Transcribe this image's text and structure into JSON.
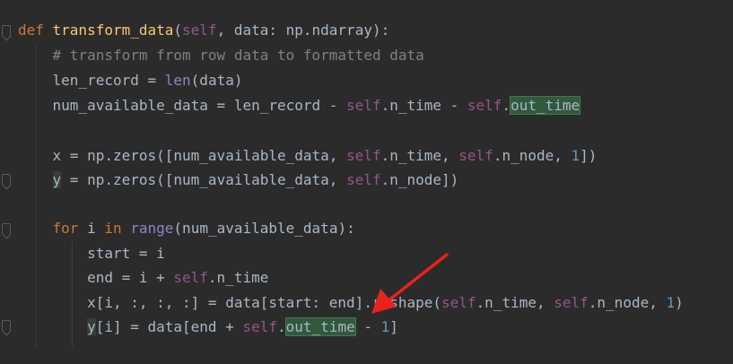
{
  "code": {
    "lines": [
      {
        "tokens": [
          {
            "t": "def ",
            "c": "kw"
          },
          {
            "t": "transform_data",
            "c": "fn"
          },
          {
            "t": "(",
            "c": ""
          },
          {
            "t": "self",
            "c": "self"
          },
          {
            "t": ", data: np.ndarray):",
            "c": ""
          }
        ]
      },
      {
        "tokens": [
          {
            "t": "    # transform from row data to formatted data",
            "c": "cmt"
          }
        ]
      },
      {
        "tokens": [
          {
            "t": "    len_record = ",
            "c": ""
          },
          {
            "t": "len",
            "c": "builtin"
          },
          {
            "t": "(data)",
            "c": ""
          }
        ]
      },
      {
        "tokens": [
          {
            "t": "    num_available_data = len_record - ",
            "c": ""
          },
          {
            "t": "self",
            "c": "self"
          },
          {
            "t": ".n_time - ",
            "c": ""
          },
          {
            "t": "self",
            "c": "self"
          },
          {
            "t": ".",
            "c": ""
          },
          {
            "t": "out_time",
            "c": "hl"
          }
        ]
      },
      {
        "tokens": []
      },
      {
        "tokens": [
          {
            "t": "    x = np.zeros([num_available_data, ",
            "c": ""
          },
          {
            "t": "self",
            "c": "self"
          },
          {
            "t": ".n_time, ",
            "c": ""
          },
          {
            "t": "self",
            "c": "self"
          },
          {
            "t": ".n_node, ",
            "c": ""
          },
          {
            "t": "1",
            "c": "num"
          },
          {
            "t": "])",
            "c": ""
          }
        ]
      },
      {
        "tokens": [
          {
            "t": "    ",
            "c": ""
          },
          {
            "t": "y",
            "c": "hl-weak"
          },
          {
            "t": " = np.zeros([num_available_data, ",
            "c": ""
          },
          {
            "t": "self",
            "c": "self"
          },
          {
            "t": ".n_node])",
            "c": ""
          }
        ]
      },
      {
        "tokens": []
      },
      {
        "tokens": [
          {
            "t": "    ",
            "c": ""
          },
          {
            "t": "for",
            "c": "kw"
          },
          {
            "t": " i ",
            "c": ""
          },
          {
            "t": "in",
            "c": "kw"
          },
          {
            "t": " ",
            "c": ""
          },
          {
            "t": "range",
            "c": "builtin"
          },
          {
            "t": "(num_available_data):",
            "c": ""
          }
        ]
      },
      {
        "tokens": [
          {
            "t": "        start = i",
            "c": ""
          }
        ]
      },
      {
        "tokens": [
          {
            "t": "        end = i + ",
            "c": ""
          },
          {
            "t": "self",
            "c": "self"
          },
          {
            "t": ".n_time",
            "c": ""
          }
        ]
      },
      {
        "tokens": [
          {
            "t": "        x[i, :, :, :] = data[start: end].reshape(",
            "c": ""
          },
          {
            "t": "self",
            "c": "self"
          },
          {
            "t": ".n_time, ",
            "c": ""
          },
          {
            "t": "self",
            "c": "self"
          },
          {
            "t": ".n_node, ",
            "c": ""
          },
          {
            "t": "1",
            "c": "num"
          },
          {
            "t": ")",
            "c": ""
          }
        ]
      },
      {
        "tokens": [
          {
            "t": "        ",
            "c": ""
          },
          {
            "t": "y",
            "c": "hl-weak"
          },
          {
            "t": "[i] = data[end + ",
            "c": ""
          },
          {
            "t": "self",
            "c": "self"
          },
          {
            "t": ".",
            "c": ""
          },
          {
            "t": "out_time",
            "c": "hl"
          },
          {
            "t": " - ",
            "c": ""
          },
          {
            "t": "1",
            "c": "num"
          },
          {
            "t": "]",
            "c": ""
          }
        ]
      }
    ]
  },
  "colors": {
    "background": "#2b2b2b",
    "keyword": "#cc7832",
    "function": "#ffc66d",
    "self": "#94558d",
    "number": "#6897bb",
    "comment": "#808080",
    "highlight": "#32593d",
    "arrow": "#e8231b"
  },
  "annotation": {
    "icon": "red-arrow-icon"
  }
}
